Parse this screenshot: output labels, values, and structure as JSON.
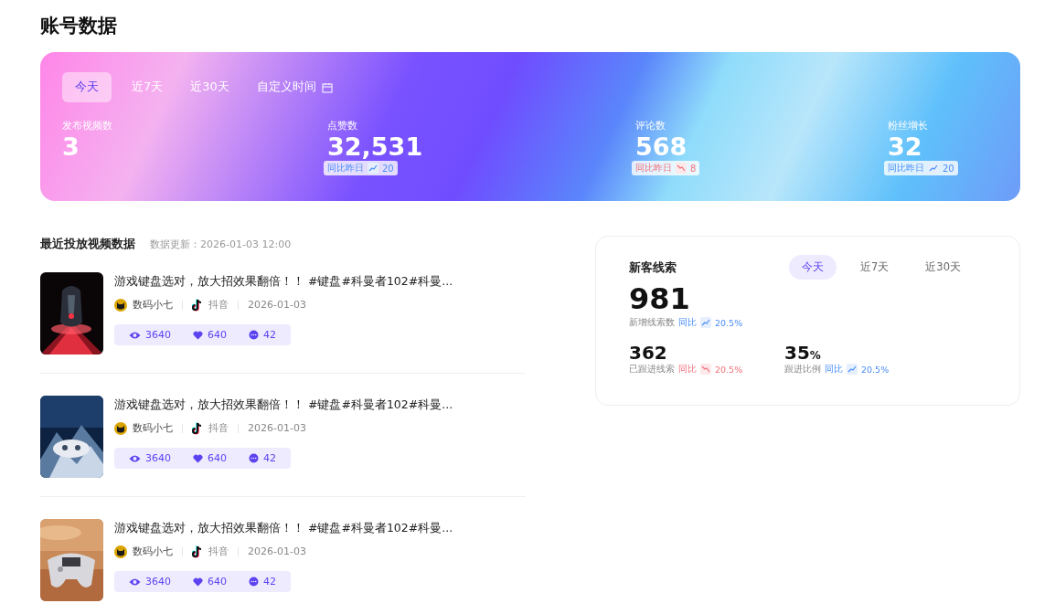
{
  "page_title": "账号数据",
  "overview": {
    "tabs": [
      {
        "label": "今天",
        "selected": true
      },
      {
        "label": "近7天",
        "selected": false
      },
      {
        "label": "近30天",
        "selected": false
      },
      {
        "label": "自定义时间",
        "selected": false,
        "kind": "calendar"
      }
    ],
    "stats": [
      {
        "label": "发布视频数",
        "value": "3"
      },
      {
        "label": "点赞数",
        "value": "32,531",
        "compare": {
          "label": "同比昨日",
          "rising": true,
          "delta": "20"
        }
      },
      {
        "label": "评论数",
        "value": "568",
        "compare": {
          "label": "同比昨日",
          "rising": false,
          "delta": "8"
        }
      },
      {
        "label": "粉丝增长",
        "value": "32",
        "compare": {
          "label": "同比昨日",
          "rising": true,
          "delta": "20"
        }
      }
    ]
  },
  "videos": {
    "title": "最近投放视频数据",
    "updated": "数据更新：2026-01-03 12:00",
    "items": [
      {
        "title": "游戏键盘选对，放大招效果翻倍！！ #键盘#科曼者102#科曼...",
        "author": "数码小七",
        "platform": "抖音",
        "date": "2026-01-03",
        "views": "3640",
        "likes": "640",
        "comments": "42"
      },
      {
        "title": "游戏键盘选对，放大招效果翻倍！！ #键盘#科曼者102#科曼...",
        "author": "数码小七",
        "platform": "抖音",
        "date": "2026-01-03",
        "views": "3640",
        "likes": "640",
        "comments": "42"
      },
      {
        "title": "游戏键盘选对，放大招效果翻倍！！ #键盘#科曼者102#科曼...",
        "author": "数码小七",
        "platform": "抖音",
        "date": "2026-01-03",
        "views": "3640",
        "likes": "640",
        "comments": "42"
      }
    ]
  },
  "leads": {
    "title": "新客线索",
    "tabs": [
      {
        "label": "今天",
        "selected": true
      },
      {
        "label": "近7天",
        "selected": false
      },
      {
        "label": "近30天",
        "selected": false
      }
    ],
    "main": {
      "value": "981",
      "label": "新增线索数",
      "compare": {
        "label": "同比",
        "rising": true,
        "delta": "20.5%"
      }
    },
    "subs": [
      {
        "value": "362",
        "label": "已跟进线索",
        "compare": {
          "label": "同比",
          "rising": false,
          "delta": "20.5%"
        }
      },
      {
        "value": "35",
        "unit": "%",
        "label": "跟进比例",
        "compare": {
          "label": "同比",
          "rising": true,
          "delta": "20.5%"
        }
      }
    ]
  }
}
